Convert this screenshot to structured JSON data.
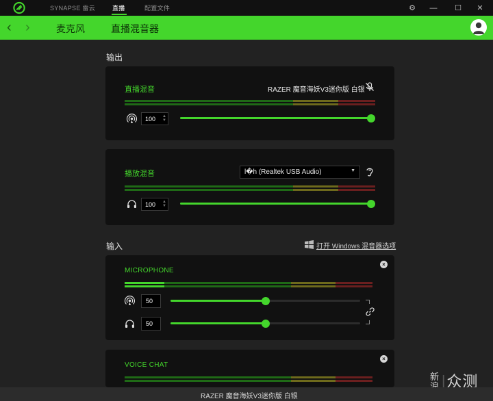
{
  "titlebar": {
    "tabs": [
      {
        "label": "SYNAPSE 雷云"
      },
      {
        "label": "直播"
      },
      {
        "label": "配置文件"
      }
    ],
    "window_buttons": {
      "settings": "⚙",
      "minimize": "—",
      "maximize": "☐",
      "close": "✕"
    }
  },
  "header": {
    "back": "‹",
    "forward": "›",
    "section": "麦克风",
    "title": "直播混音器"
  },
  "output": {
    "label": "输出",
    "stream_mix": {
      "title": "直播混音",
      "device": "RAZER 魔音海妖V3迷你版 白银",
      "value": "100",
      "level_fraction": 1.0
    },
    "playback_mix": {
      "title": "播放混音",
      "device_selected": "l�h (Realtek USB Audio)",
      "value": "100",
      "level_fraction": 1.0
    }
  },
  "input": {
    "label": "输入",
    "windows_link": "打开 Windows 混音器选项",
    "microphone": {
      "title": "MICROPHONE",
      "stream_value": "50",
      "monitor_value": "50",
      "stream_fraction": 0.5,
      "monitor_fraction": 0.5
    },
    "voice_chat": {
      "title": "VOICE CHAT"
    }
  },
  "status": {
    "text": "RAZER 魔音海妖V3迷你版 白银"
  },
  "watermark": {
    "small": "新浪",
    "big": "众测"
  },
  "colors": {
    "accent": "#44d62c",
    "background": "#222222",
    "card": "#111111"
  }
}
